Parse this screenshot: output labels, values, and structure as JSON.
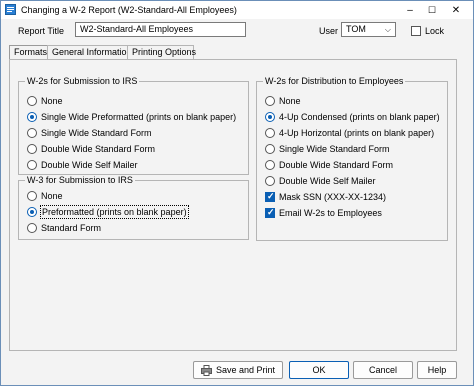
{
  "window": {
    "title": "Changing a W-2 Report  (W2-Standard-All Employees)",
    "minimize": "–",
    "maximize": "☐",
    "close": "✕"
  },
  "header": {
    "report_title_label": "Report Title",
    "report_title_value": "W2-Standard-All Employees",
    "user_label": "User",
    "user_value": "TOM",
    "lock_label": "Lock",
    "lock_checked": false
  },
  "tabs": [
    {
      "label": "Formats",
      "active": true
    },
    {
      "label": "General Information",
      "active": false
    },
    {
      "label": "Printing Options",
      "active": false
    }
  ],
  "irs_group": {
    "title": "W-2s for Submission to IRS",
    "options": [
      {
        "label": "None",
        "selected": false
      },
      {
        "label": "Single Wide Preformatted (prints on blank paper)",
        "selected": true
      },
      {
        "label": "Single Wide Standard Form",
        "selected": false
      },
      {
        "label": "Double Wide Standard Form",
        "selected": false
      },
      {
        "label": "Double Wide Self Mailer",
        "selected": false
      }
    ]
  },
  "w3_group": {
    "title": "W-3 for Submission to IRS",
    "options": [
      {
        "label": "None",
        "selected": false
      },
      {
        "label": "Preformatted (prints on blank paper)",
        "selected": true
      },
      {
        "label": "Standard Form",
        "selected": false
      }
    ]
  },
  "emp_group": {
    "title": "W-2s for Distribution to Employees",
    "options": [
      {
        "label": "None",
        "selected": false
      },
      {
        "label": "4-Up Condensed (prints on blank paper)",
        "selected": true
      },
      {
        "label": "4-Up Horizontal (prints on blank paper)",
        "selected": false
      },
      {
        "label": "Single Wide Standard Form",
        "selected": false
      },
      {
        "label": "Double Wide Standard Form",
        "selected": false
      },
      {
        "label": "Double Wide Self Mailer",
        "selected": false
      }
    ],
    "checks": [
      {
        "label": "Mask SSN (XXX-XX-1234)",
        "checked": true
      },
      {
        "label": "Email W-2s to Employees",
        "checked": true
      }
    ]
  },
  "buttons": {
    "save_print": "Save and Print",
    "ok": "OK",
    "cancel": "Cancel",
    "help": "Help"
  }
}
